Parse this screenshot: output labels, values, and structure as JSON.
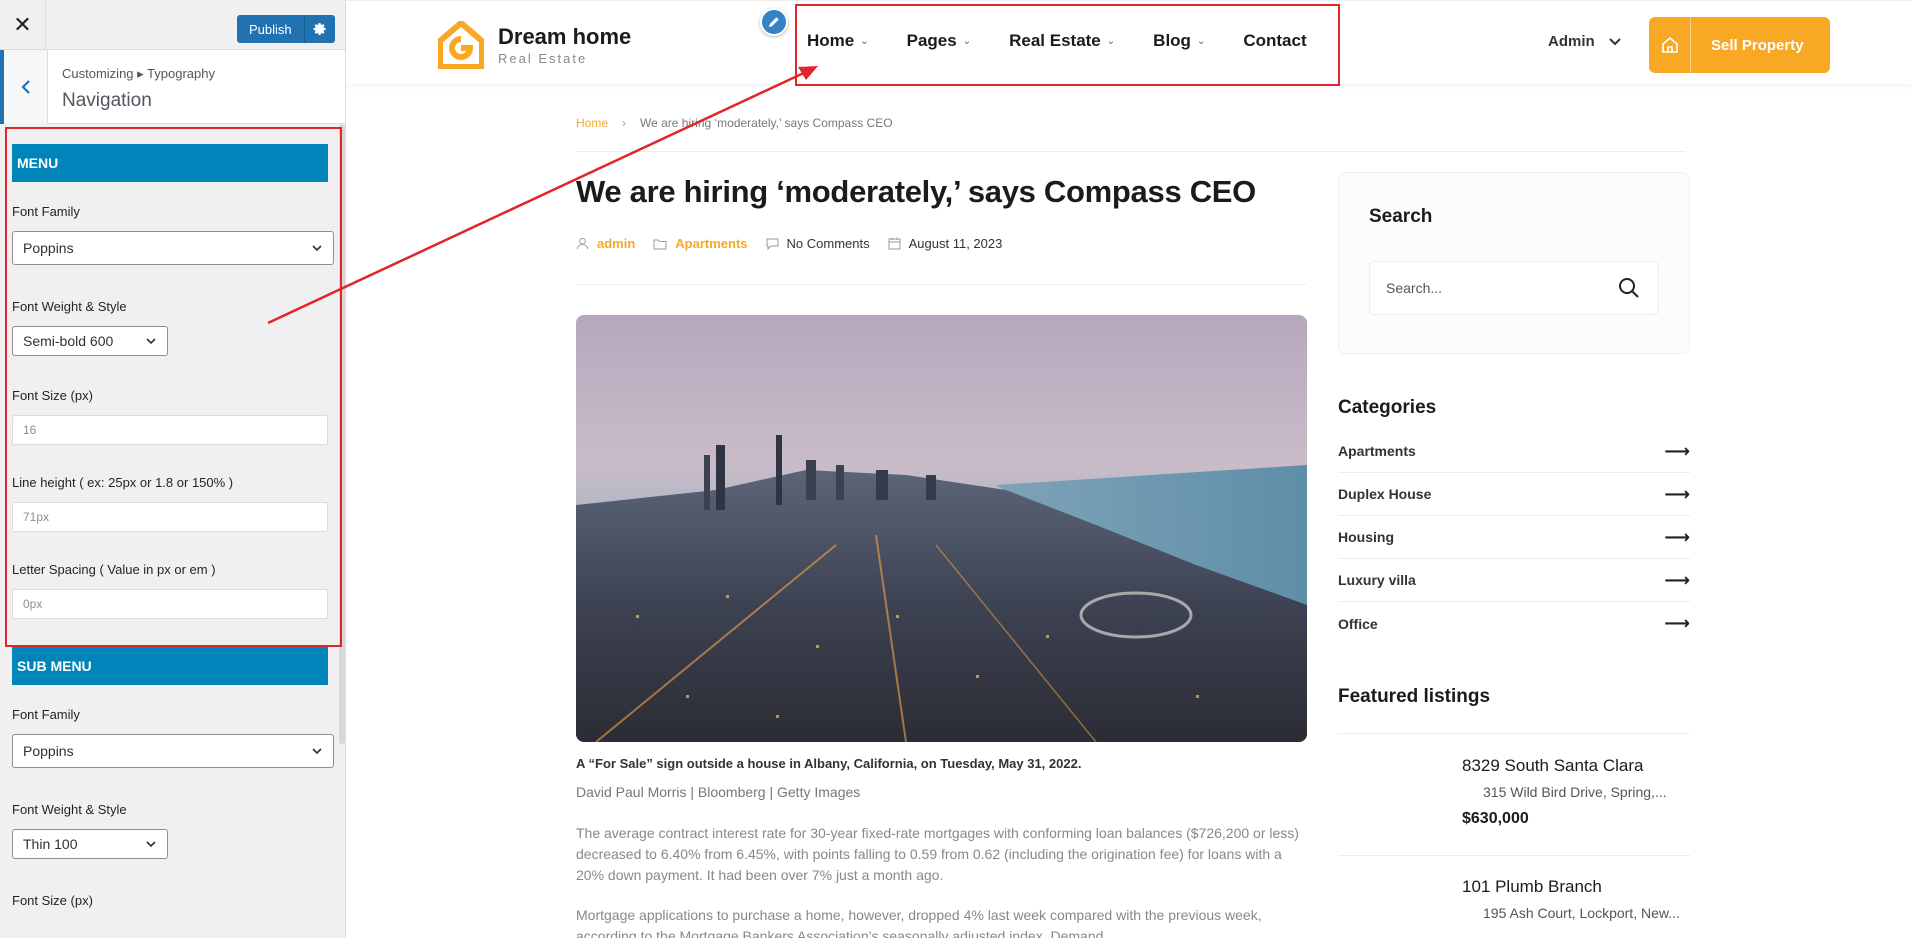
{
  "customizer": {
    "close_label": "✕",
    "publish_label": "Publish",
    "breadcrumb": "Customizing ▸ Typography",
    "section_title": "Navigation",
    "menu": {
      "group_title": "MENU",
      "font_family_label": "Font Family",
      "font_family_value": "Poppins",
      "font_weight_label": "Font Weight & Style",
      "font_weight_value": "Semi-bold 600",
      "font_size_label": "Font Size (px)",
      "font_size_value": "16",
      "line_height_label": "Line height ( ex: 25px or 1.8 or 150% )",
      "line_height_value": "71px",
      "letter_spacing_label": "Letter Spacing ( Value in px or em )",
      "letter_spacing_value": "0px"
    },
    "submenu": {
      "group_title": "SUB MENU",
      "font_family_label": "Font Family",
      "font_family_value": "Poppins",
      "font_weight_label": "Font Weight & Style",
      "font_weight_value": "Thin 100",
      "font_size_label": "Font Size (px)"
    }
  },
  "site": {
    "logo_name": "Dream home",
    "logo_tagline": "Real Estate",
    "nav": [
      {
        "label": "Home",
        "caret": "⌄"
      },
      {
        "label": "Pages",
        "caret": "⌄"
      },
      {
        "label": "Real Estate",
        "caret": "⌄"
      },
      {
        "label": "Blog",
        "caret": "⌄"
      },
      {
        "label": "Contact",
        "caret": ""
      }
    ],
    "admin_label": "Admin",
    "sell_label": "Sell Property",
    "breadcrumb": {
      "home": "Home",
      "sep": "›",
      "current": "We are hiring ‘moderately,’ says Compass CEO"
    },
    "post": {
      "title": "We are hiring ‘moderately,’ says Compass CEO",
      "author": "admin",
      "category": "Apartments",
      "comments": "No Comments",
      "date": "August 11, 2023",
      "caption_bold": "A “For Sale” sign outside a house in Albany, California, on Tuesday, May 31, 2022.",
      "caption_credit": "David Paul Morris | Bloomberg | Getty Images",
      "para1": "The average contract interest rate for 30-year fixed-rate mortgages with conforming loan balances ($726,200 or less) decreased to 6.40% from 6.45%, with points falling to 0.59 from 0.62 (including the origination fee) for loans with a 20% down payment. It had been over 7% just a month ago.",
      "para2": "Mortgage applications to purchase a home, however, dropped 4% last week compared with the previous week, according to the Mortgage Bankers Association’s seasonally adjusted index. Demand"
    },
    "search": {
      "title": "Search",
      "placeholder": "Search..."
    },
    "categories": {
      "title": "Categories",
      "items": [
        "Apartments",
        "Duplex House",
        "Housing",
        "Luxury villa",
        "Office"
      ]
    },
    "featured": {
      "title": "Featured listings",
      "items": [
        {
          "name": "8329 South Santa Clara",
          "address": "315 Wild Bird Drive, Spring,...",
          "price": "$630,000"
        },
        {
          "name": "101 Plumb Branch",
          "address": "195 Ash Court, Lockport, New..."
        }
      ]
    }
  },
  "colors": {
    "accent": "#f9a826",
    "wp_blue": "#2271b1",
    "group_blue": "#0085ba",
    "annotation_red": "#e0262a"
  }
}
